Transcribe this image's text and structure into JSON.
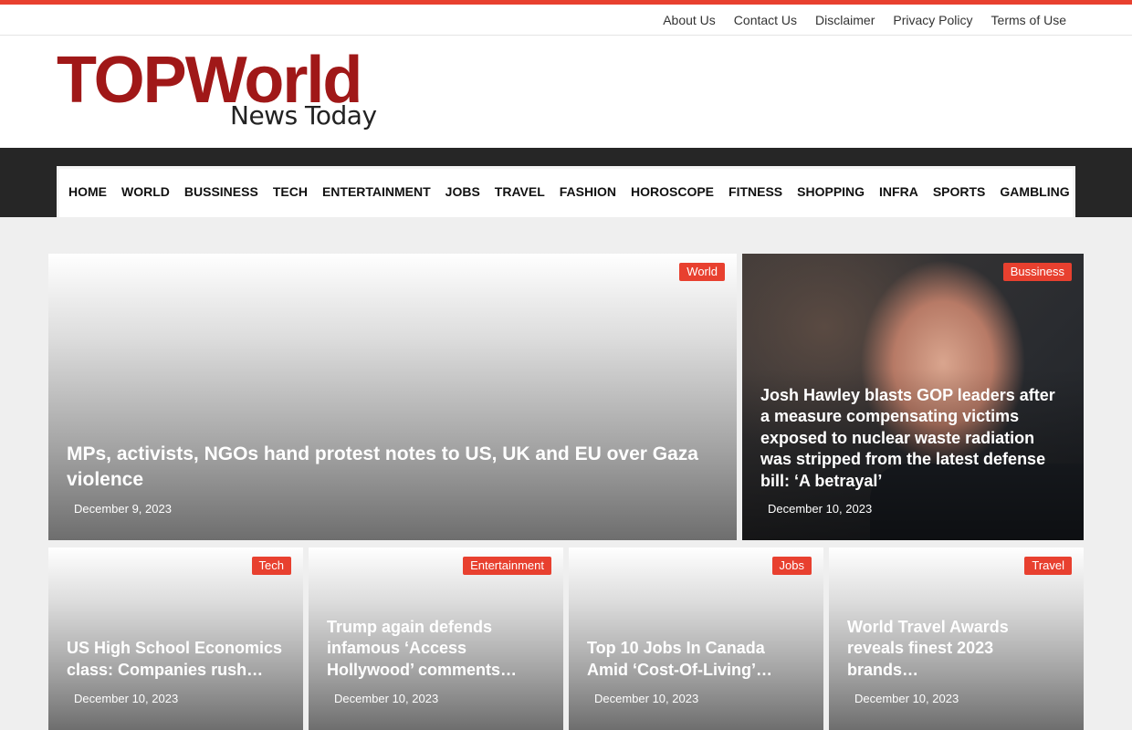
{
  "topnav": {
    "links": [
      "About Us",
      "Contact Us",
      "Disclaimer",
      "Privacy Policy",
      "Terms of Use"
    ]
  },
  "logo": {
    "main": "TOPWorld",
    "sub": "News Today"
  },
  "mainnav": {
    "items": [
      "HOME",
      "WORLD",
      "BUSSINESS",
      "TECH",
      "ENTERTAINMENT",
      "JOBS",
      "TRAVEL",
      "FASHION",
      "HOROSCOPE",
      "FITNESS",
      "SHOPPING",
      "INFRA",
      "SPORTS",
      "GAMBLING"
    ]
  },
  "articles": [
    {
      "category": "World",
      "title": "MPs, activists, NGOs hand protest notes to US, UK and EU over Gaza violence",
      "date": "December 9, 2023"
    },
    {
      "category": "Bussiness",
      "title": "Josh Hawley blasts GOP leaders after a measure compensating victims exposed to nuclear waste radiation was stripped from the latest defense bill: ‘A betrayal’",
      "date": "December 10, 2023"
    },
    {
      "category": "Tech",
      "title": "US High School Economics class: Companies rush…",
      "date": "December 10, 2023"
    },
    {
      "category": "Entertainment",
      "title": "Trump again defends infamous ‘Access Hollywood’ comments…",
      "date": "December 10, 2023"
    },
    {
      "category": "Jobs",
      "title": "Top 10 Jobs In Canada Amid ‘Cost-Of-Living’…",
      "date": "December 10, 2023"
    },
    {
      "category": "Travel",
      "title": "World Travel Awards reveals finest 2023 brands…",
      "date": "December 10, 2023"
    }
  ],
  "colors": {
    "accent": "#e8402f",
    "logo_red": "#a01818",
    "nav_dark": "#262626"
  }
}
